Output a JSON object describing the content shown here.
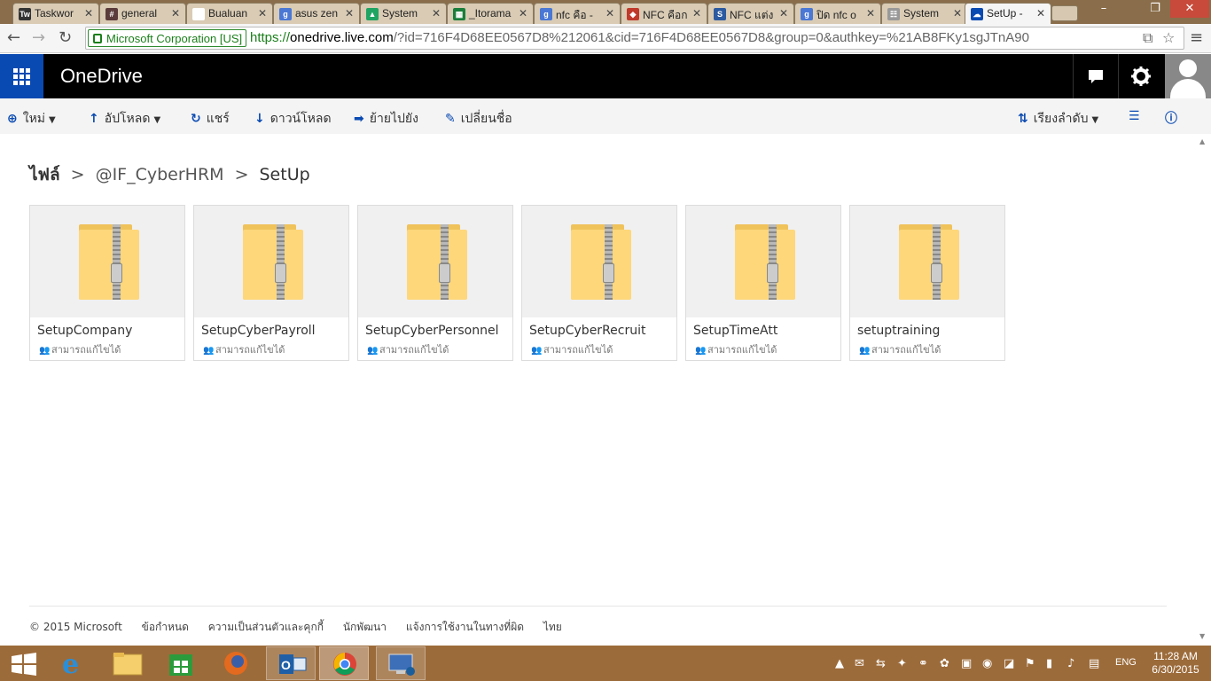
{
  "browser": {
    "tabs": [
      {
        "label": "Taskwor",
        "fav": "Tw",
        "fav_color": "#333333"
      },
      {
        "label": "general",
        "fav": "#",
        "fav_color": "#5b3b3b"
      },
      {
        "label": "Bualuan",
        "fav": "",
        "fav_color": "#ffffff"
      },
      {
        "label": "asus zen",
        "fav": "g",
        "fav_color": "#4a78d4"
      },
      {
        "label": "System",
        "fav": "▲",
        "fav_color": "#1fa463"
      },
      {
        "label": "_Itorama",
        "fav": "▦",
        "fav_color": "#1a7f3c"
      },
      {
        "label": "nfc คือ -",
        "fav": "g",
        "fav_color": "#4a78d4"
      },
      {
        "label": "NFC คือก",
        "fav": "◆",
        "fav_color": "#c0392b"
      },
      {
        "label": "NFC แต่ง",
        "fav": "S",
        "fav_color": "#2c5aa0"
      },
      {
        "label": "ปิด nfc o",
        "fav": "g",
        "fav_color": "#4a78d4"
      },
      {
        "label": "System",
        "fav": "☷",
        "fav_color": "#999999"
      },
      {
        "label": "SetUp -",
        "fav": "☁",
        "fav_color": "#094ab2"
      }
    ],
    "ev_label": "Microsoft Corporation [US]",
    "url_scheme": "https://",
    "url_host": "onedrive.live.com",
    "url_rest": "/?id=716F4D68EE0567D8%212061&cid=716F4D68EE0567D8&group=0&authkey=%21AB8FKy1sgJTnA90"
  },
  "app": {
    "brand": "OneDrive"
  },
  "commands": {
    "new": "ใหม่",
    "upload": "อัปโหลด",
    "share": "แชร์",
    "download": "ดาวน์โหลด",
    "move": "ย้ายไปยัง",
    "rename": "เปลี่ยนชื่อ",
    "sort": "เรียงลำดับ"
  },
  "breadcrumb": {
    "root": "ไฟล์",
    "parent": "@IF_CyberHRM",
    "current": "SetUp"
  },
  "files": [
    {
      "name": "SetupCompany",
      "status": "สามารถแก้ไขได้"
    },
    {
      "name": "SetupCyberPayroll",
      "status": "สามารถแก้ไขได้"
    },
    {
      "name": "SetupCyberPersonnel",
      "status": "สามารถแก้ไขได้"
    },
    {
      "name": "SetupCyberRecruit",
      "status": "สามารถแก้ไขได้"
    },
    {
      "name": "SetupTimeAtt",
      "status": "สามารถแก้ไขได้"
    },
    {
      "name": "setuptraining",
      "status": "สามารถแก้ไขได้"
    }
  ],
  "footer": {
    "copyright": "© 2015 Microsoft",
    "terms": "ข้อกำหนด",
    "privacy": "ความเป็นส่วนตัวและคุกกี้",
    "developers": "นักพัฒนา",
    "report": "แจ้งการใช้งานในทางที่ผิด",
    "language": "ไทย"
  },
  "taskbar": {
    "lang": "ENG",
    "time": "11:28 AM",
    "date": "6/30/2015"
  },
  "colors": {
    "accent": "#094ab2",
    "header": "#000000",
    "folder": "#fdd77a"
  }
}
